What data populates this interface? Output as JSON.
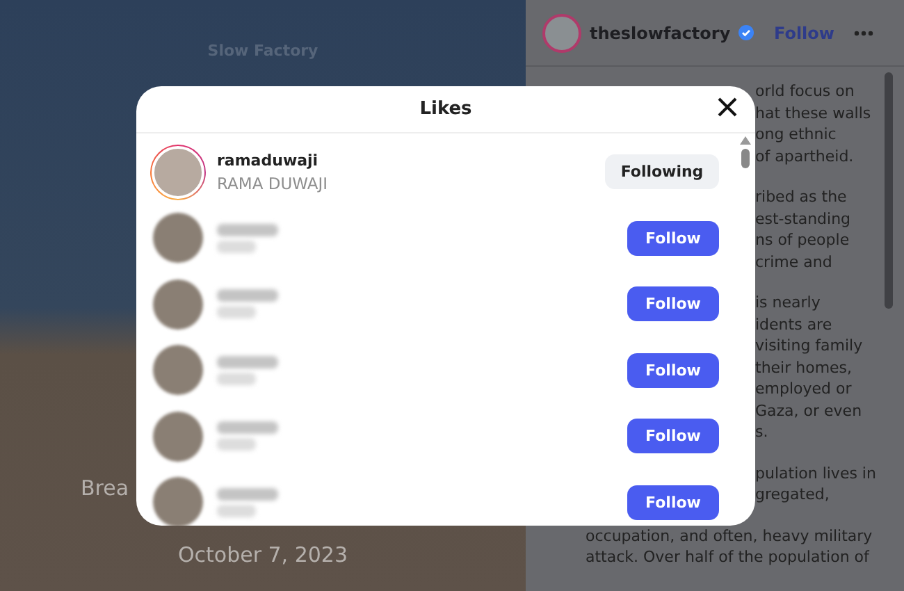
{
  "background_post": {
    "photo_text": "Slow Factory",
    "caption_lines": [
      "Brea"
    ],
    "date": "October 7, 2023"
  },
  "post_panel": {
    "account": "theslowfactory",
    "verified": true,
    "follow_button": "Follow",
    "body_paragraphs": [
      [
        "orld focus on",
        "hat these walls",
        "ong ethnic",
        "of apartheid."
      ],
      [
        "ribed as the",
        "est-standing",
        "ns of people",
        "crime and"
      ],
      [
        "is nearly",
        "idents are",
        "visiting family",
        "their homes,",
        "employed or",
        "Gaza, or even",
        "s."
      ],
      [
        "pulation lives in",
        "gregated,"
      ]
    ],
    "body_full_lines": [
      "occupation, and often, heavy military",
      "attack. Over half of the population of"
    ]
  },
  "likes_dialog": {
    "title": "Likes",
    "users": [
      {
        "kind": "visible",
        "username": "ramaduwaji",
        "full_name": "RAMA DUWAJI",
        "story_ring": true,
        "button": "Following",
        "following": true
      },
      {
        "kind": "blurred",
        "story_ring": false,
        "button": "Follow",
        "following": false
      },
      {
        "kind": "blurred",
        "story_ring": false,
        "button": "Follow",
        "following": false
      },
      {
        "kind": "blurred",
        "story_ring": false,
        "button": "Follow",
        "following": false
      },
      {
        "kind": "blurred",
        "story_ring": false,
        "button": "Follow",
        "following": false
      },
      {
        "kind": "blurred",
        "story_ring": false,
        "button": "Follow",
        "following": false
      }
    ]
  }
}
